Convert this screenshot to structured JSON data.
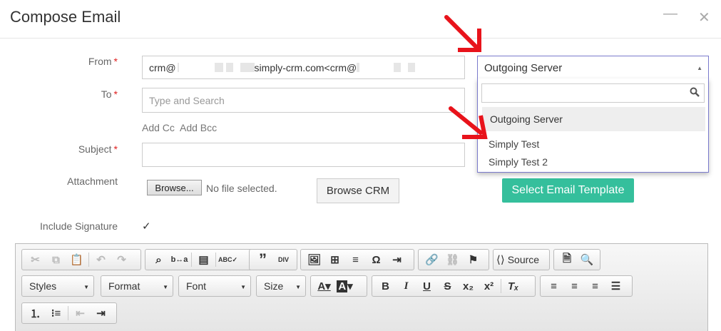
{
  "header": {
    "title": "Compose Email",
    "minimize_glyph": "—",
    "close_glyph": "✕"
  },
  "form": {
    "from_label": "From",
    "from_value_prefix": "crm@",
    "from_value_mid": "simply-crm.com<crm@",
    "to_label": "To",
    "to_placeholder": "Type and Search",
    "add_cc": "Add Cc",
    "add_bcc": "Add Bcc",
    "subject_label": "Subject",
    "subject_value": "",
    "attachment_label": "Attachment",
    "browse_label": "Browse...",
    "no_file": "No file selected.",
    "browse_crm": "Browse CRM",
    "template_button": "Select Email Template",
    "signature_label": "Include Signature",
    "signature_checked": true,
    "required_mark": "*"
  },
  "server_select": {
    "value": "Outgoing Server",
    "options": [
      "Outgoing Server",
      "Simply Test",
      "Simply Test 2"
    ],
    "selected_index": 0
  },
  "toolbar": {
    "combos": [
      "Styles",
      "Format",
      "Font",
      "Size"
    ],
    "source_label": "Source"
  },
  "colors": {
    "accent": "#35bf9c",
    "required": "#e02020",
    "arrow": "#e8131b"
  }
}
